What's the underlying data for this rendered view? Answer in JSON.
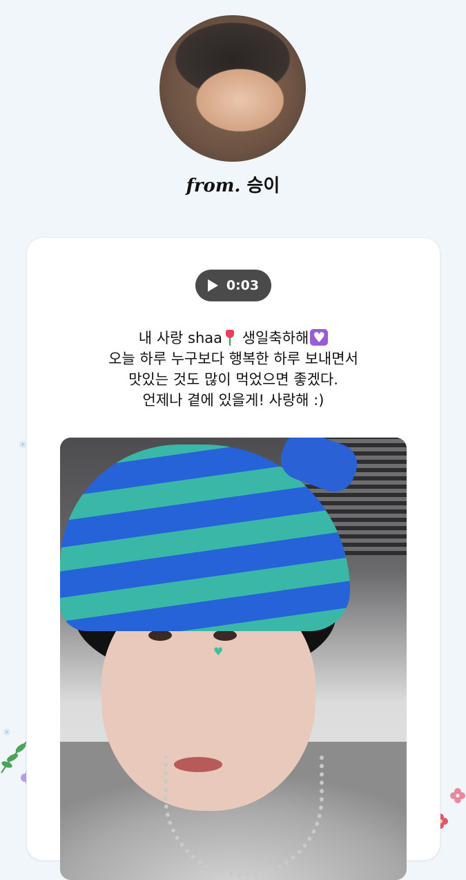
{
  "profile": {
    "from_prefix": "from.",
    "name": "승이"
  },
  "voice_player": {
    "play_icon": "play-icon",
    "duration": "0:03"
  },
  "message": {
    "line1_a": "내 사랑 shaa",
    "line1_b": " 생일축하해",
    "line2": "오늘 하루 누구보다 행복한 하루 보내면서",
    "line3": "맛있는 것도 많이 먹었으면 좋겠다.",
    "line4": "언제나 곁에 있을게! 사랑해 :)"
  },
  "colors": {
    "background": "#f1f6fb",
    "card": "#ffffff",
    "play_button": "#4a4a4a",
    "heart_emoji": "#9b5bd4",
    "tulip_emoji": "#e8405c"
  }
}
